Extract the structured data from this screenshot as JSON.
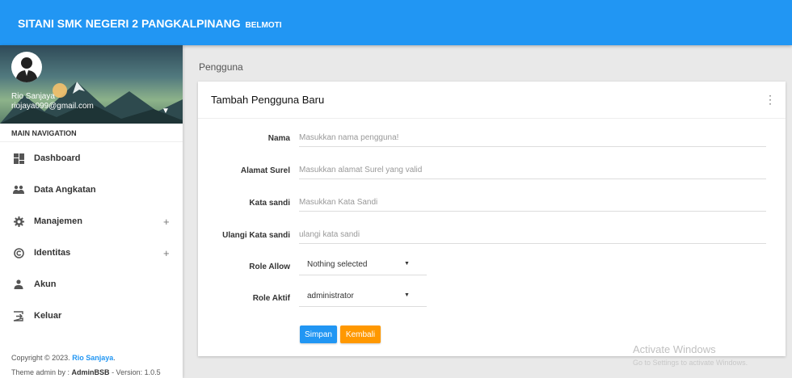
{
  "topbar": {
    "brand": "SITANI SMK NEGERI 2 PANGKALPINANG",
    "brand_small": "BELMOTI"
  },
  "user": {
    "name": "Rio Sanjaya",
    "email": "riojaya099@gmail.com"
  },
  "nav": {
    "header": "MAIN NAVIGATION",
    "items": [
      {
        "label": "Dashboard",
        "icon": "dashboard-icon",
        "expandable": false
      },
      {
        "label": "Data Angkatan",
        "icon": "people-icon",
        "expandable": false
      },
      {
        "label": "Manajemen",
        "icon": "gear-icon",
        "expandable": true
      },
      {
        "label": "Identitas",
        "icon": "copyright-icon",
        "expandable": true
      },
      {
        "label": "Akun",
        "icon": "person-icon",
        "expandable": false
      },
      {
        "label": "Keluar",
        "icon": "logout-icon",
        "expandable": false
      }
    ],
    "expand_symbol": "+"
  },
  "footer": {
    "copyright_prefix": "Copyright © 2023.",
    "copyright_name": "Rio Sanjaya",
    "copyright_suffix": ".",
    "theme_prefix": "Theme admin by :",
    "theme_name": "AdminBSB",
    "version": "- Version: 1.0.5"
  },
  "breadcrumb": "Pengguna",
  "card": {
    "title": "Tambah Pengguna Baru",
    "fields": [
      {
        "label": "Nama",
        "placeholder": "Masukkan nama pengguna!",
        "value": ""
      },
      {
        "label": "Alamat Surel",
        "placeholder": "Masukkan alamat Surel yang valid",
        "value": ""
      },
      {
        "label": "Kata sandi",
        "placeholder": "Masukkan Kata Sandi",
        "value": ""
      },
      {
        "label": "Ulangi Kata sandi",
        "placeholder": "ulangi kata sandi",
        "value": ""
      }
    ],
    "selects": [
      {
        "label": "Role Allow",
        "value": "Nothing selected"
      },
      {
        "label": "Role Aktif",
        "value": "administrator"
      }
    ],
    "save_label": "Simpan",
    "back_label": "Kembali"
  },
  "watermark": {
    "line1": "Activate Windows",
    "line2": "Go to Settings to activate Windows."
  },
  "colors": {
    "primary": "#2196F3",
    "accent": "#FF9800"
  }
}
